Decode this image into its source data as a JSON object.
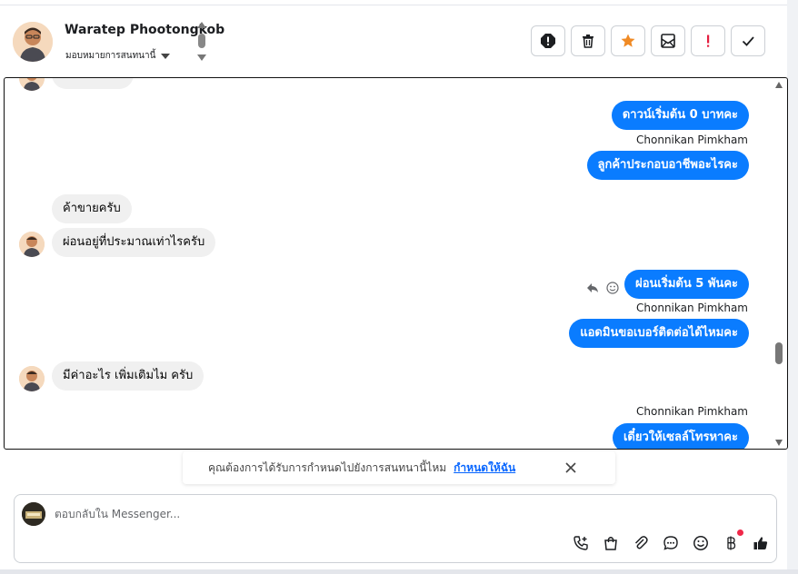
{
  "header": {
    "name": "Waratep Phootongkob",
    "assign_label": "มอบหมายการสนทนานี้"
  },
  "actions": [
    {
      "name": "report-icon",
      "color": "#1c1e21"
    },
    {
      "name": "trash-icon",
      "color": "#1c1e21"
    },
    {
      "name": "star-icon",
      "color": "#f08a24"
    },
    {
      "name": "mark-unread-icon",
      "color": "#1c1e21"
    },
    {
      "name": "exclamation-icon",
      "color": "#e41e3f"
    },
    {
      "name": "check-icon",
      "color": "#1c1e21"
    }
  ],
  "conversation": {
    "messages": [
      {
        "side": "out",
        "text": "ดาวน์เริ่มต้น 0 บาทคะ"
      },
      {
        "side": "out",
        "sender": "Chonnikan Pimkham",
        "text": "ลูกค้าประกอบอาชีพอะไรคะ"
      },
      {
        "side": "in",
        "text": "ค้าขายครับ"
      },
      {
        "side": "in",
        "text": "ผ่อนอยู่ที่ประมาณเท่าไรครับ"
      },
      {
        "side": "out",
        "text": "ผ่อนเริ่มต้น 5 พันคะ"
      },
      {
        "side": "out",
        "sender": "Chonnikan Pimkham",
        "text": "แอดมินขอเบอร์ติดต่อได้ไหมคะ"
      },
      {
        "side": "in",
        "text": "มีค่าอะไร เพิ่มเติมไม ครับ"
      },
      {
        "side": "out",
        "sender": "Chonnikan Pimkham",
        "text": "เดี๋ยวให้เซลล์โทรหาคะ"
      }
    ]
  },
  "notice": {
    "text": "คุณต้องการได้รับการกำหนดไปยังการสนทนานี้ไหม",
    "link": "กำหนดให้ฉัน"
  },
  "composer": {
    "placeholder": "ตอบกลับใน Messenger...",
    "tools": [
      "call-add-icon",
      "shopping-bag-icon",
      "paperclip-icon",
      "chat-bubble-icon",
      "emoji-icon",
      "baht-icon",
      "thumbs-up-icon"
    ]
  },
  "colors": {
    "outgoing_bubble": "#0a7cff",
    "incoming_bubble": "#f0f0f0",
    "link": "#0866ff"
  }
}
